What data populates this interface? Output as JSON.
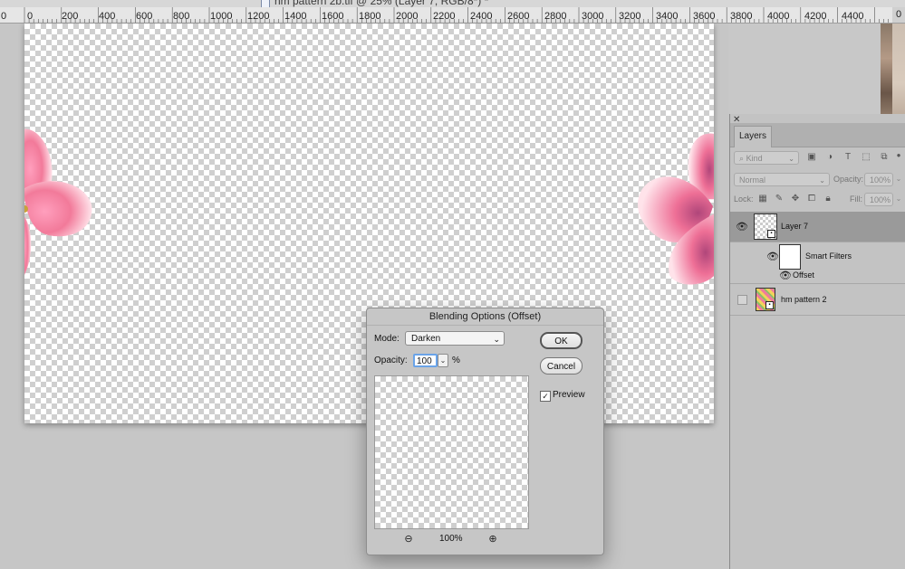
{
  "document": {
    "title": "hm pattern 2b.tif @ 25% (Layer 7, RGB/8*) *"
  },
  "ruler": {
    "labels": [
      "0",
      "200",
      "400",
      "600",
      "800",
      "1000",
      "1200",
      "1400",
      "1600",
      "1800",
      "2000",
      "2200",
      "2400",
      "2600",
      "2800",
      "3000",
      "3200",
      "3400",
      "3600",
      "3800",
      "4000",
      "4200",
      "4400"
    ],
    "left_label": "0",
    "end_label": "0"
  },
  "layers_panel": {
    "tab_label": "Layers",
    "filter_kind": "Kind",
    "blend_mode": "Normal",
    "opacity_label": "Opacity:",
    "opacity_value": "100%",
    "lock_label": "Lock:",
    "fill_label": "Fill:",
    "fill_value": "100%",
    "layers": [
      {
        "name": "Layer 7",
        "selected": true
      },
      {
        "name": "Smart Filters"
      },
      {
        "name": "Offset"
      },
      {
        "name": "hm pattern 2"
      }
    ]
  },
  "dialog": {
    "title": "Blending Options (Offset)",
    "mode_label": "Mode:",
    "mode_value": "Darken",
    "opacity_label": "Opacity:",
    "opacity_value": "100",
    "percent": "%",
    "ok_label": "OK",
    "cancel_label": "Cancel",
    "preview_label": "Preview",
    "preview_checked": true,
    "zoom_level": "100%"
  },
  "colors": {
    "petal": "#f27a9a",
    "petal_light": "#ffd9e2",
    "accent_focus": "#6aa3e8"
  }
}
